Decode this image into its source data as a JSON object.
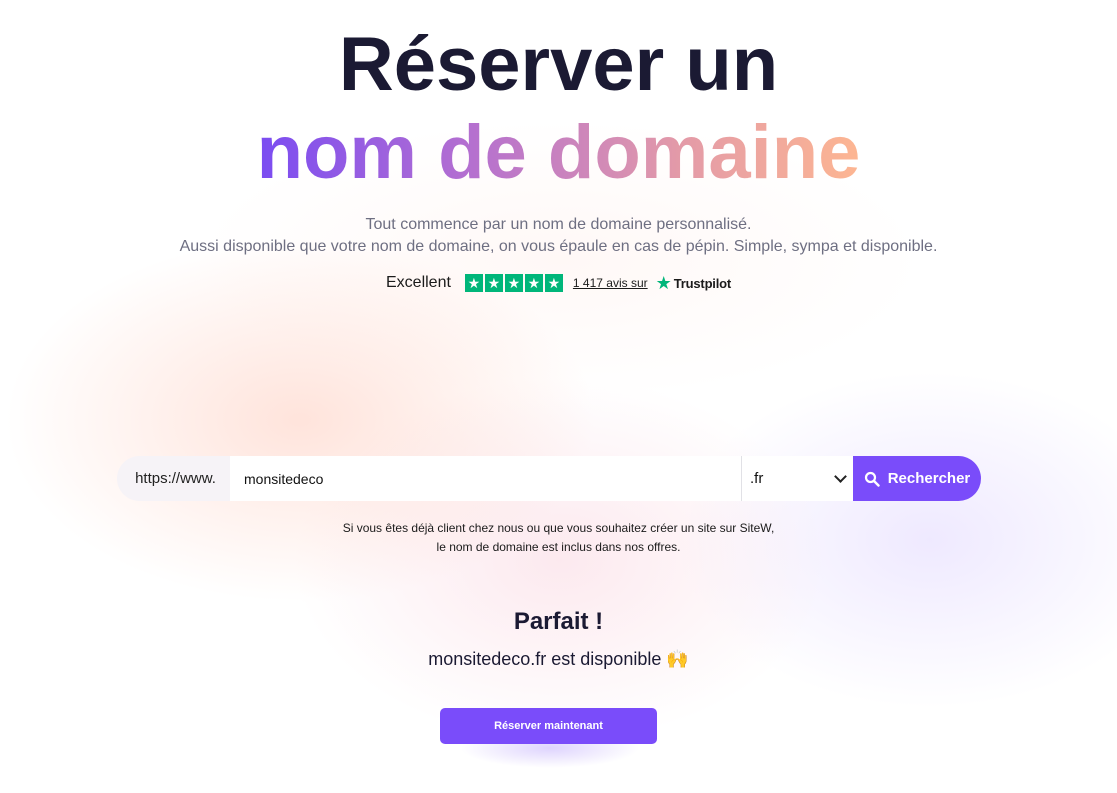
{
  "hero": {
    "title_line1": "Réserver un",
    "title_line2": "nom de domaine",
    "subtitle_line1": "Tout commence par un nom de domaine personnalisé.",
    "subtitle_line2": "Aussi disponible que votre nom de domaine, on vous épaule en cas de pépin. Simple, sympa et disponible."
  },
  "trustpilot": {
    "rating_label": "Excellent",
    "stars": 5,
    "reviews_link": "1 417 avis sur",
    "brand": "Trustpilot",
    "color": "#00b67a"
  },
  "search": {
    "prefix": "https://www.",
    "domain_value": "monsitedeco",
    "tld_selected": ".fr",
    "button_label": "Rechercher",
    "accent_color": "#7a4cfa"
  },
  "note": {
    "line1": "Si vous êtes déjà client chez nous ou que vous souhaitez créer un site sur SiteW,",
    "line2": "le nom de domaine est inclus dans nos offres."
  },
  "result": {
    "title": "Parfait !",
    "message": "monsitedeco.fr est disponible 🙌",
    "cta_label": "Réserver maintenant"
  }
}
